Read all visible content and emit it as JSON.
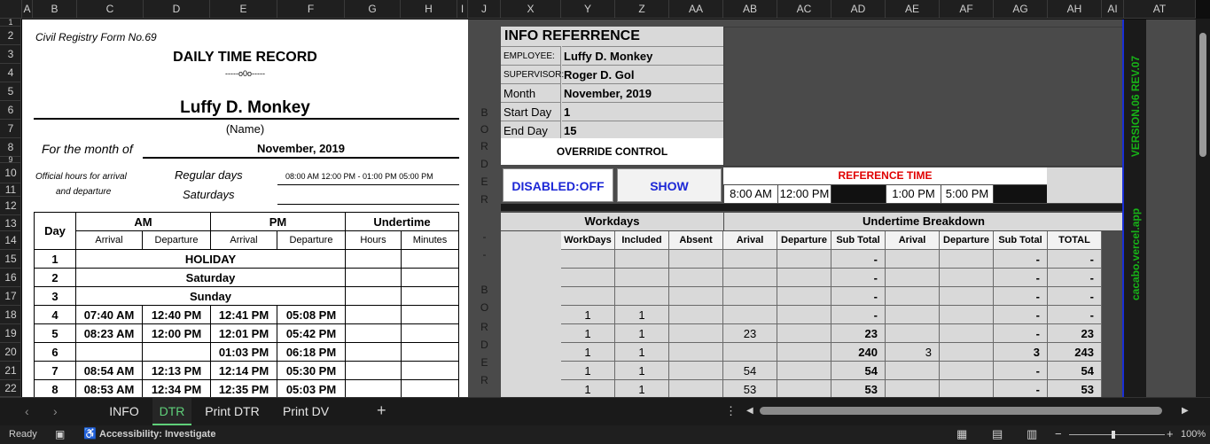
{
  "columns": [
    "A",
    "B",
    "C",
    "D",
    "E",
    "F",
    "G",
    "H",
    "I",
    "J",
    "X",
    "Y",
    "Z",
    "AA",
    "AB",
    "AC",
    "AD",
    "AE",
    "AF",
    "AG",
    "AH",
    "AI",
    "AT"
  ],
  "rows": [
    "1",
    "2",
    "3",
    "4",
    "5",
    "6",
    "7",
    "8",
    "9",
    "10",
    "11",
    "12",
    "13",
    "14",
    "15",
    "16",
    "17",
    "18",
    "19",
    "20",
    "21",
    "22"
  ],
  "form": {
    "civil": "Civil Registry Form No.69",
    "title": "DAILY TIME RECORD",
    "sep": "-----o0o-----",
    "employee": "Luffy D. Monkey",
    "name_label": "(Name)",
    "month_label": "For the month of",
    "month": "November, 2019",
    "official": "Official hours for arrival",
    "official2": "and departure",
    "regular": "Regular days",
    "regular_val": "08:00 AM 12:00 PM - 01:00 PM 05:00 PM",
    "saturdays": "Saturdays"
  },
  "dtr": {
    "headers": {
      "day": "Day",
      "am": "AM",
      "pm": "PM",
      "undertime": "Undertime",
      "arrival": "Arrival",
      "departure": "Departure",
      "hours": "Hours",
      "minutes": "Minutes"
    },
    "rows": [
      {
        "day": "1",
        "span": "HOLIDAY"
      },
      {
        "day": "2",
        "span": "Saturday"
      },
      {
        "day": "3",
        "span": "Sunday"
      },
      {
        "day": "4",
        "a1": "07:40 AM",
        "d1": "12:40 PM",
        "a2": "12:41 PM",
        "d2": "05:08 PM"
      },
      {
        "day": "5",
        "a1": "08:23 AM",
        "d1": "12:00 PM",
        "a2": "12:01 PM",
        "d2": "05:42 PM"
      },
      {
        "day": "6",
        "a1": "",
        "d1": "",
        "a2": "01:03 PM",
        "d2": "06:18 PM"
      },
      {
        "day": "7",
        "a1": "08:54 AM",
        "d1": "12:13 PM",
        "a2": "12:14 PM",
        "d2": "05:30 PM"
      },
      {
        "day": "8",
        "a1": "08:53 AM",
        "d1": "12:34 PM",
        "a2": "12:35 PM",
        "d2": "05:03 PM"
      }
    ]
  },
  "border_text": [
    "B",
    "O",
    "R",
    "D",
    "E",
    "R",
    "-",
    "-",
    "B",
    "O",
    "R",
    "D",
    "E",
    "R"
  ],
  "info": {
    "title": "INFO REFERRENCE",
    "employee_label": "EMPLOYEE:",
    "employee": "Luffy D. Monkey",
    "supervisor_label": "SUPERVISOR:",
    "supervisor": "Roger D. Gol",
    "month_label": "Month",
    "month": "November, 2019",
    "start_label": "Start Day",
    "start": "1",
    "end_label": "End Day",
    "end": "15",
    "override": "OVERRIDE CONTROL",
    "disabled": "DISABLED:OFF",
    "show": "SHOW",
    "ref_title": "REFERENCE TIME",
    "ref_times": [
      "8:00 AM",
      "12:00 PM",
      "",
      "1:00 PM",
      "5:00 PM"
    ]
  },
  "breakdown": {
    "workdays_title": "Workdays",
    "undertime_title": "Undertime Breakdown",
    "cols": [
      "WorkDays",
      "Included",
      "Absent",
      "Arival",
      "Departure",
      "Sub Total",
      "Arival",
      "Departure",
      "Sub Total",
      "TOTAL"
    ],
    "rows": [
      [
        "",
        "",
        "",
        "",
        "",
        "-",
        "",
        "",
        "-",
        "-"
      ],
      [
        "",
        "",
        "",
        "",
        "",
        "-",
        "",
        "",
        "-",
        "-"
      ],
      [
        "",
        "",
        "",
        "",
        "",
        "-",
        "",
        "",
        "-",
        "-"
      ],
      [
        "1",
        "1",
        "",
        "",
        "",
        "-",
        "",
        "",
        "-",
        "-"
      ],
      [
        "1",
        "1",
        "",
        "23",
        "",
        "23",
        "",
        "",
        "-",
        "23"
      ],
      [
        "1",
        "1",
        "",
        "",
        "",
        "240",
        "3",
        "",
        "3",
        "243"
      ],
      [
        "1",
        "1",
        "",
        "54",
        "",
        "54",
        "",
        "",
        "-",
        "54"
      ],
      [
        "1",
        "1",
        "",
        "53",
        "",
        "53",
        "",
        "",
        "-",
        "53"
      ]
    ]
  },
  "version": "VERSION.06 REV.07",
  "site": "cacabo.vercel.app",
  "tabs": [
    "INFO",
    "DTR",
    "Print DTR",
    "Print DV"
  ],
  "active_tab": "DTR",
  "status": {
    "ready": "Ready",
    "access": "Accessibility: Investigate",
    "zoom": "100%"
  }
}
